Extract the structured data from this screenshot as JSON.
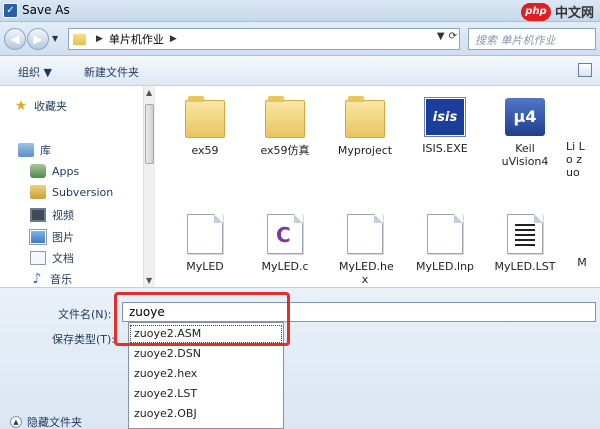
{
  "window": {
    "title": "Save As"
  },
  "watermark": {
    "logo": "php",
    "site": "中文网"
  },
  "nav": {
    "breadcrumb": [
      "单片机作业"
    ],
    "search_placeholder": "搜索 单片机作业"
  },
  "toolbar": {
    "organize": "组织 ▼",
    "new_folder": "新建文件夹"
  },
  "sidebar": {
    "favorites": "收藏夹",
    "libraries": "库",
    "items": [
      "Apps",
      "Subversion",
      "视频",
      "图片",
      "文档",
      "音乐"
    ]
  },
  "files": {
    "row1": [
      "ex59",
      "ex59仿真",
      "Myproject",
      "ISIS.EXE",
      "Keil uVision4",
      "Li Lo zuo"
    ],
    "row2": [
      "MyLED",
      "MyLED.c",
      "MyLED.he x",
      "MyLED.lnp",
      "MyLED.LST",
      "M"
    ],
    "isis_logo": "isis",
    "keil_logo": "μ4"
  },
  "form": {
    "filename_label": "文件名(N):",
    "filename_value": "zuoye",
    "filetype_label": "保存类型(T):",
    "autocomplete": [
      "zuoye2.ASM",
      "zuoye2.DSN",
      "zuoye2.hex",
      "zuoye2.LST",
      "zuoye2.OBJ"
    ]
  },
  "footer": {
    "hide_folders": "隐藏文件夹"
  },
  "colors": {
    "highlight": "#e0302a",
    "accent": "#1e395b"
  }
}
